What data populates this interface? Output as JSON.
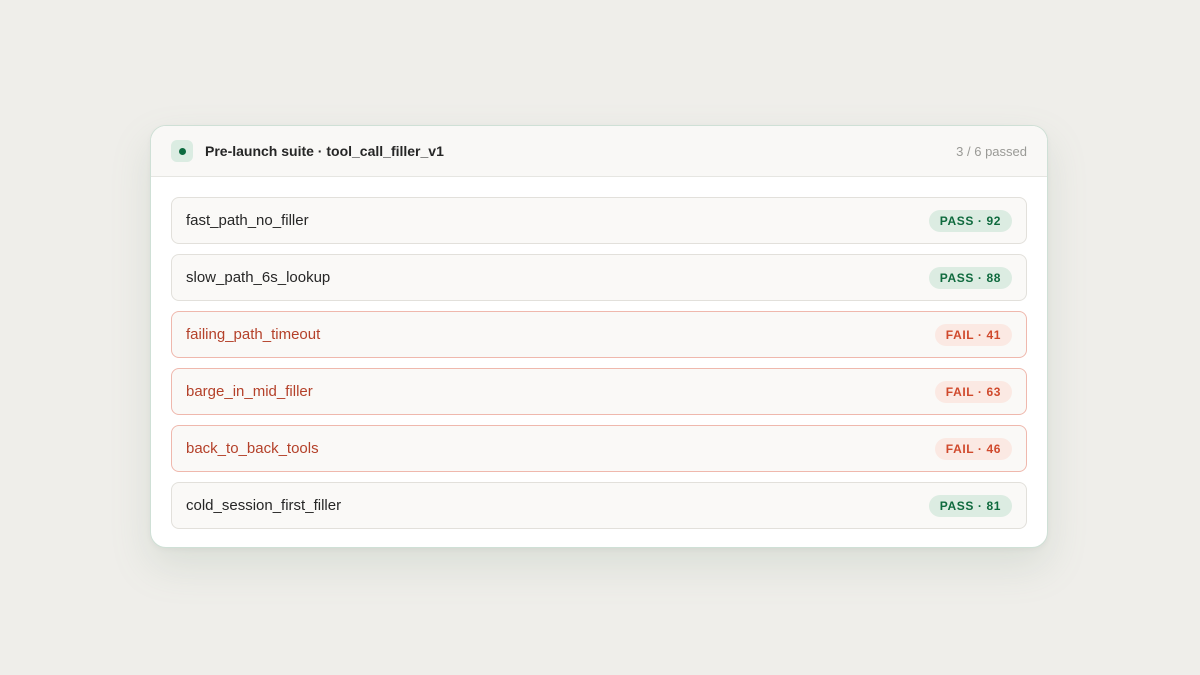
{
  "suite": {
    "title": "Pre-launch suite · tool_call_filler_v1",
    "summary": "3 / 6 passed"
  },
  "tests": [
    {
      "name": "fast_path_no_filler",
      "status": "pass",
      "badge": "PASS · 92"
    },
    {
      "name": "slow_path_6s_lookup",
      "status": "pass",
      "badge": "PASS · 88"
    },
    {
      "name": "failing_path_timeout",
      "status": "fail",
      "badge": "FAIL · 41"
    },
    {
      "name": "barge_in_mid_filler",
      "status": "fail",
      "badge": "FAIL · 63"
    },
    {
      "name": "back_to_back_tools",
      "status": "fail",
      "badge": "FAIL · 46"
    },
    {
      "name": "cold_session_first_filler",
      "status": "pass",
      "badge": "PASS · 81"
    }
  ],
  "colors": {
    "pass": "#0f6a3e",
    "fail": "#d0492c",
    "accent": "#0c6a3f"
  }
}
